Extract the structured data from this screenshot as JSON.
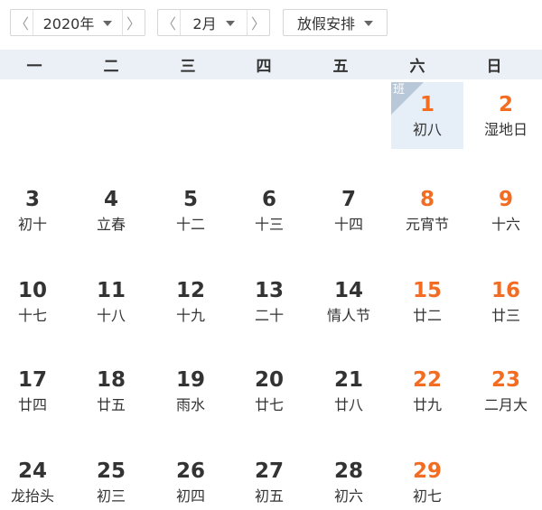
{
  "toolbar": {
    "year": {
      "prev": "〈",
      "value": "2020年",
      "next": "〉"
    },
    "month": {
      "prev": "〈",
      "value": "2月",
      "next": "〉"
    },
    "holiday": {
      "value": "放假安排"
    }
  },
  "weekdays": [
    "一",
    "二",
    "三",
    "四",
    "五",
    "六",
    "日"
  ],
  "badge": "班",
  "colors": {
    "weekend_number": "#f26d22",
    "header_bg": "#eaf0f6",
    "today_bg": "#e6eef7"
  },
  "weeks": [
    [
      null,
      null,
      null,
      null,
      null,
      {
        "day": "1",
        "lunar": "初八"
      },
      {
        "day": "2",
        "lunar": "湿地日"
      }
    ],
    [
      {
        "day": "3",
        "lunar": "初十"
      },
      {
        "day": "4",
        "lunar": "立春"
      },
      {
        "day": "5",
        "lunar": "十二"
      },
      {
        "day": "6",
        "lunar": "十三"
      },
      {
        "day": "7",
        "lunar": "十四"
      },
      {
        "day": "8",
        "lunar": "元宵节"
      },
      {
        "day": "9",
        "lunar": "十六"
      }
    ],
    [
      {
        "day": "10",
        "lunar": "十七"
      },
      {
        "day": "11",
        "lunar": "十八"
      },
      {
        "day": "12",
        "lunar": "十九"
      },
      {
        "day": "13",
        "lunar": "二十"
      },
      {
        "day": "14",
        "lunar": "情人节"
      },
      {
        "day": "15",
        "lunar": "廿二"
      },
      {
        "day": "16",
        "lunar": "廿三"
      }
    ],
    [
      {
        "day": "17",
        "lunar": "廿四"
      },
      {
        "day": "18",
        "lunar": "廿五"
      },
      {
        "day": "19",
        "lunar": "雨水"
      },
      {
        "day": "20",
        "lunar": "廿七"
      },
      {
        "day": "21",
        "lunar": "廿八"
      },
      {
        "day": "22",
        "lunar": "廿九"
      },
      {
        "day": "23",
        "lunar": "二月大"
      }
    ],
    [
      {
        "day": "24",
        "lunar": "龙抬头"
      },
      {
        "day": "25",
        "lunar": "初三"
      },
      {
        "day": "26",
        "lunar": "初四"
      },
      {
        "day": "27",
        "lunar": "初五"
      },
      {
        "day": "28",
        "lunar": "初六"
      },
      {
        "day": "29",
        "lunar": "初七"
      },
      null
    ]
  ]
}
